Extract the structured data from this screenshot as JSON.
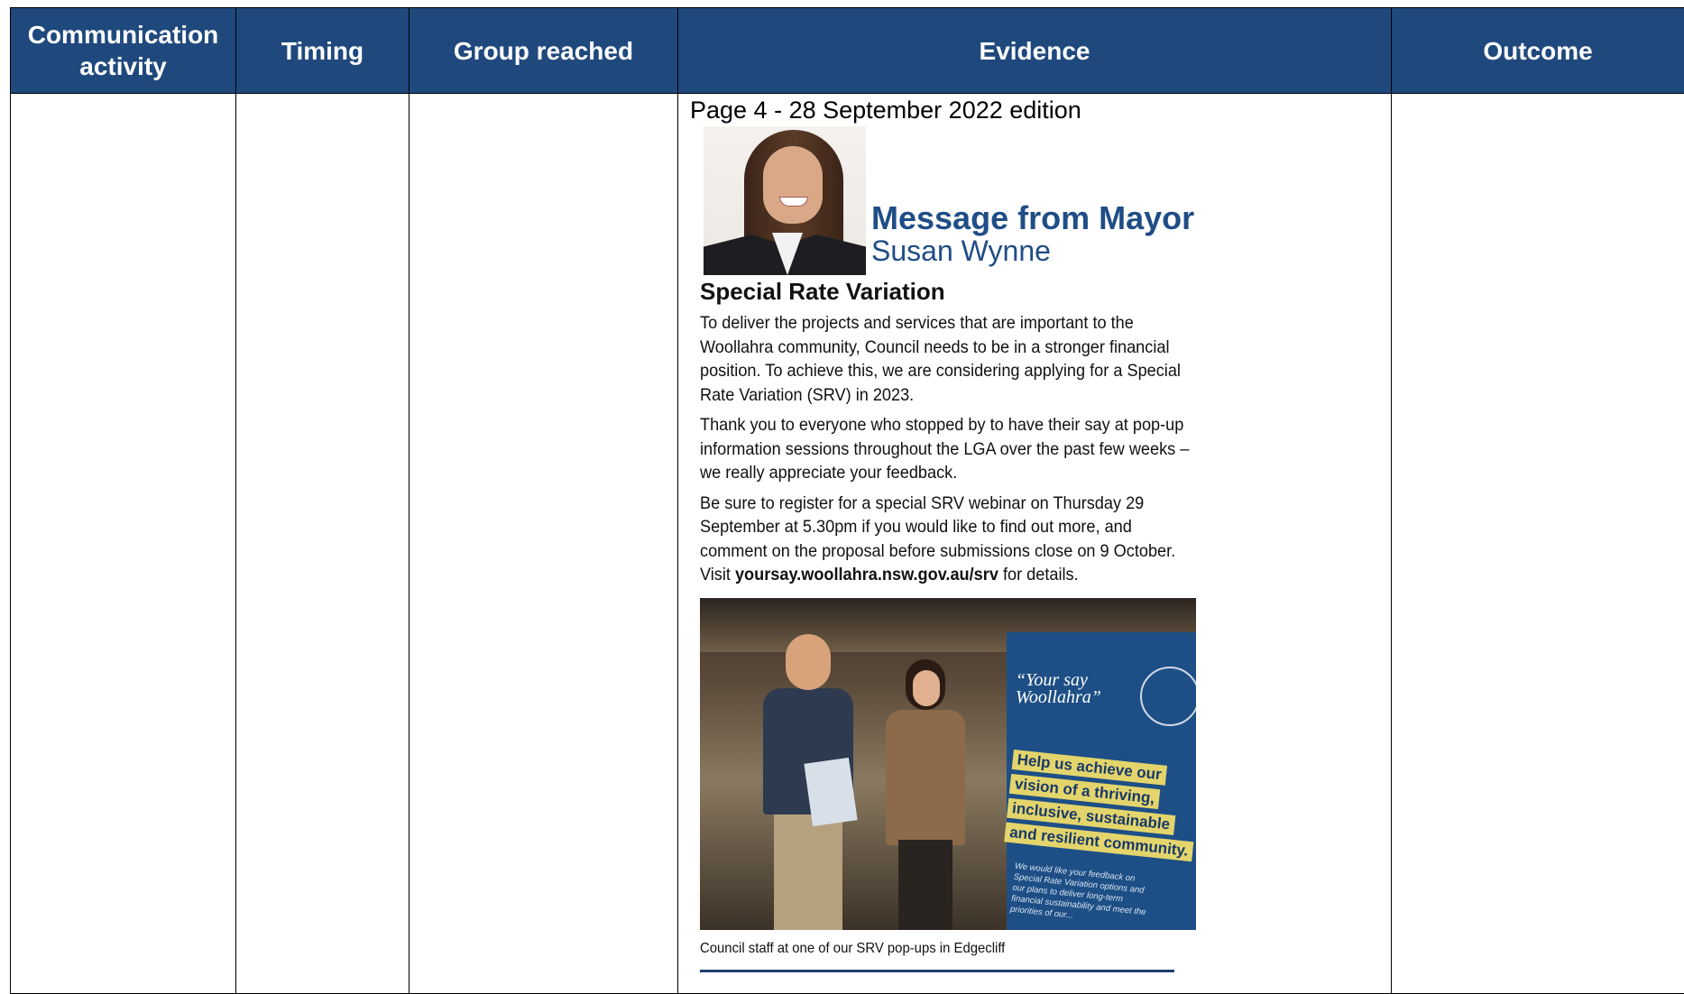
{
  "table": {
    "headers": [
      "Communication activity",
      "Timing",
      "Group reached",
      "Evidence",
      "Outcome"
    ],
    "header_bg": "#1f497d"
  },
  "evidence": {
    "caption": "Page 4 - 28 September 2022 edition",
    "mayor_title_line1": "Message from Mayor",
    "mayor_title_line2": "Susan Wynne",
    "article_heading": "Special Rate Variation",
    "paragraphs": [
      "To deliver the projects and services that are important to the Woollahra community, Council needs to be in a stronger financial position. To achieve this, we are considering applying for a Special Rate Variation (SRV) in 2023.",
      "Thank you to everyone who stopped by to have their say at pop-up information sessions throughout the LGA over the past few weeks – we really appreciate your feedback."
    ],
    "p3_text": "Be sure to register for a special SRV webinar on Thursday 29 September at 5.30pm if you would like to find out more, and comment on the proposal before submissions close on 9 October. Visit ",
    "p3_link": "yoursay.woollahra.nsw.gov.au/srv",
    "p3_end": " for details.",
    "sign": {
      "quote_line1": "“Your say",
      "quote_line2": "Woollahra”",
      "banner": [
        "Help us achieve our",
        "vision of a thriving,",
        "inclusive, sustainable",
        "and resilient community."
      ],
      "small_text": "We would like your feedback on Special Rate Variation options and our plans to deliver long-term financial sustainability and meet the priorities of our..."
    },
    "photo_caption": "Council staff at one of our SRV pop-ups in Edgecliff"
  }
}
